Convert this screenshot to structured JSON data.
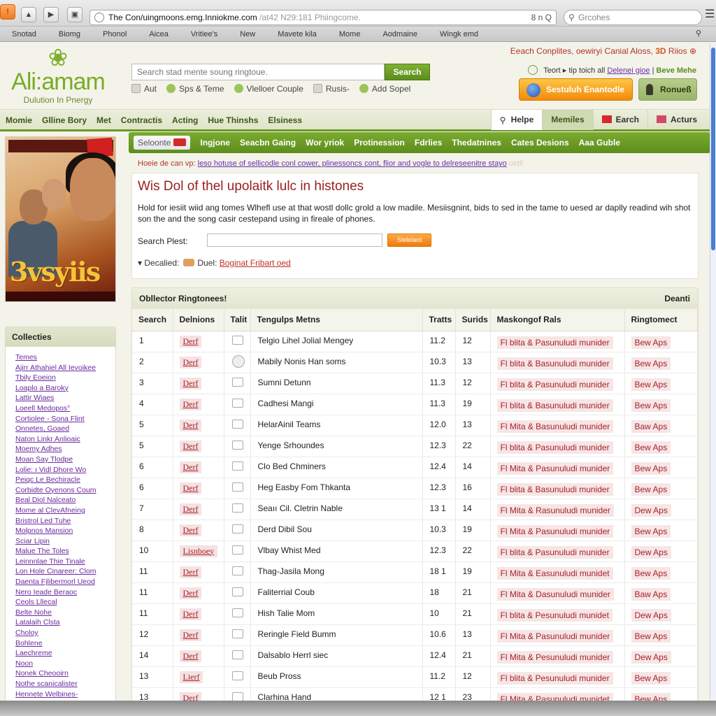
{
  "browser": {
    "url_main": "The Con/uingmoons.emg.Inniokme.com",
    "url_rest": " /at42 N29:181 Phiingcome.",
    "url_right": "8 n  Q",
    "search_placeholder": "Grcohes",
    "bookmarks": [
      "Snotad",
      "Biomg",
      "Phonol",
      "Aicea",
      "Vritiee's",
      "New",
      "Mavete kila",
      "Mome",
      "Aodmaine",
      "Wingk emd"
    ]
  },
  "site": {
    "logo_name": "Ali:amam",
    "logo_tagline": "Dulution In Pnergy",
    "search_placeholder": "Search stad mente soung ringtoue.",
    "search_button": "Search",
    "quick_links": [
      "Aut",
      "Sps & Teme",
      "Vlelloer Couple",
      "Rusis-",
      "Add Sopel"
    ],
    "promo_text": "Eeach Conplites, oewiryi  Canial Aloss, ",
    "promo_num": "3D",
    "promo_tail": " Riios",
    "text_line_pre": "Teort  ▸ tip toich all ",
    "text_line_link": "Delenei gioe",
    "text_line_sep": " | ",
    "text_line_green": "Beve Mehe",
    "orange_button": "Sestuluh Enantodle",
    "green_button": "Ronueß"
  },
  "nav": {
    "left": [
      "Momie",
      "Glline Bory",
      "Met",
      "Contractis",
      "Acting",
      "Hue Thinshs",
      "Elsiness"
    ],
    "right": [
      {
        "label": "Helpe",
        "state": "active"
      },
      {
        "label": "Memiles",
        "state": "selected"
      },
      {
        "label": "Earch",
        "state": "normal"
      },
      {
        "label": "Acturs",
        "state": "normal"
      }
    ]
  },
  "sidebar": {
    "poster_title": "3vsyiis",
    "collections_title": "Collecties",
    "collections": [
      "Temes",
      "Ajirr Athahiel All Ievoikee",
      "Tbily Eoeion",
      "Loaplo a Baroky",
      "Lattir Wiaes",
      "Loeell Medopos°",
      "Cortiolee - Sona Flint",
      "Onnetes, Goaed",
      "Naton Linkr Anlioaic",
      "Moemy Adhes",
      "Moan Say Tlodpe",
      "Lolie: ı Vidl Dhore Wo",
      "Peiqc Le Bechiracle",
      "Corbidte Oyenons Coum",
      "Beal Diol Nalceato",
      "Mome al ClevAfneing",
      "Bristrol Led Tuhe",
      "Molpnos Mansion",
      "Sciar Lipin",
      "Malue The Toles",
      "Leinnnlae Thie Tinale",
      "Lon Hole Cinareer: Clom",
      "Daenta Fjlibermorl Ueod",
      "Nero Ieade Beraoc",
      "Ceols Lllecal",
      "Belte Nohe",
      "Latalaih Clsta",
      "Choloy",
      "Bohlene",
      "Laechreme",
      "Noon",
      "Nonek Cheooirn",
      "Nothe scanicalister",
      "Hennete Welbines-"
    ]
  },
  "main": {
    "tabs": [
      "Seloonte",
      "Ingjone",
      "Seacbn Gaing",
      "Wor yriok",
      "Protinession",
      "Fdrlies",
      "Thedatnines",
      "Cates Desions",
      "Aaa Guble"
    ],
    "breadline_label": "Hoeie de can vp: ",
    "breadline_link": "leso hotuse of sellicodle conl cower, plinessoncs cont, flior and vogle to delreseenitre stayo",
    "breadline_faded": " oetll",
    "info_title": "Wis Dol of thel upolaitk lulc in histones",
    "info_desc": "Hold for iesiit wiid ang tomes Wlhefl use at that wostl dollc grold a low madile. Mesiisgnint, bids to sed in the tame to uesed ar daplly readind wih shot son the and the song casir cestepand using in fireale of phones.",
    "search_label": "Search Plest:",
    "search_value": "",
    "search_button": "Stelelard",
    "detail_label": "▾  Decalied:",
    "detail_mid": "Duel:",
    "detail_link": "Boginat Fribart oed"
  },
  "table": {
    "title": "Obllector Ringtonees!",
    "title_right": "Deanti",
    "columns": [
      "Search",
      "Delnions",
      "Talit",
      "Tengulps Metns",
      "Tratts",
      "Surids",
      "Maskongof Rals",
      "Ringtomect"
    ],
    "rows": [
      {
        "search": "1",
        "def": "Derf",
        "ctl": "box",
        "name": "Telgio Lihel  Jolial Mengey",
        "tratts": "11.2",
        "surids": "12",
        "mask": "Fl blita & Pasunuludi munider",
        "ring": "Bew Aps"
      },
      {
        "search": "2",
        "def": "Derf",
        "ctl": "round",
        "name": "Mabily Nonis Han soms",
        "tratts": "10.3",
        "surids": "13",
        "mask": "Fl blita & Basunuludi munider",
        "ring": "Bew Aps"
      },
      {
        "search": "3",
        "def": "Derf",
        "ctl": "box",
        "name": "Sumni Detunn",
        "tratts": "11.3",
        "surids": "12",
        "mask": "Fl blita & Pasunuludi munider",
        "ring": "Bew Aps"
      },
      {
        "search": "4",
        "def": "Derf",
        "ctl": "box",
        "name": "Cadhesi Mangi",
        "tratts": "11.3",
        "surids": "19",
        "mask": "Fl blita & Basunuludi munider",
        "ring": "Bew Aps"
      },
      {
        "search": "5",
        "def": "Derf",
        "ctl": "box",
        "name": "HelarAinil Teams",
        "tratts": "12.0",
        "surids": "13",
        "mask": "Fl Mita & Basunuludi munider",
        "ring": "Baw Aps"
      },
      {
        "search": "5",
        "def": "Derf",
        "ctl": "box",
        "name": "Yenge Srhoundes",
        "tratts": "12.3",
        "surids": "22",
        "mask": "Fl blita & Pasunuludi munider",
        "ring": "Bew Aps"
      },
      {
        "search": "6",
        "def": "Derf",
        "ctl": "box",
        "name": "Clo Bed Chminers",
        "tratts": "12.4",
        "surids": "14",
        "mask": "Fl Mita & Pasunuludi munider",
        "ring": "Bew Aps"
      },
      {
        "search": "6",
        "def": "Derf",
        "ctl": "box",
        "name": "Heg Easby Fom Thkanta",
        "tratts": "12.3",
        "surids": "16",
        "mask": "Fl blita & Basunuludi munider",
        "ring": "Bew Aps"
      },
      {
        "search": "7",
        "def": "Derf",
        "ctl": "box",
        "name": "Seaıı Cil. Cletrin Nable",
        "tratts": "13 1",
        "surids": "14",
        "mask": "Fl Mita & Rasunuludi munider",
        "ring": "Dew Aps"
      },
      {
        "search": "8",
        "def": "Derf",
        "ctl": "box",
        "name": "Derd Dibil Sou",
        "tratts": "10.3",
        "surids": "19",
        "mask": "Fl Mita & Pasunuludi munider",
        "ring": "Bew Aps"
      },
      {
        "search": "10",
        "def": "Lisnboey",
        "ctl": "box",
        "name": "Vlbay Whist Med",
        "tratts": "12.3",
        "surids": "22",
        "mask": "Fl blita & Pasunuludi munider",
        "ring": "Dew Aps"
      },
      {
        "search": "11",
        "def": "Derf",
        "ctl": "box",
        "name": "Thag-Jasila Mong",
        "tratts": "18 1",
        "surids": "19",
        "mask": "Fl Mita & Easunuludi munidet",
        "ring": "Bew Aps"
      },
      {
        "search": "11",
        "def": "Derf",
        "ctl": "box",
        "name": "Faliterrial Coub",
        "tratts": "18",
        "surids": "21",
        "mask": "Fl Mita & Dasunuludi munider",
        "ring": "Baw Aps"
      },
      {
        "search": "11",
        "def": "Derf",
        "ctl": "box",
        "name": "Hish Talie Mom",
        "tratts": "10",
        "surids": "21",
        "mask": "Fl blita & Pesunuludi munidet",
        "ring": "Dew Aps"
      },
      {
        "search": "12",
        "def": "Derf",
        "ctl": "box",
        "name": "Reringle Field Bumm",
        "tratts": "10.6",
        "surids": "13",
        "mask": "Fl Mita & Pasunuludi munider",
        "ring": "Bew Aps"
      },
      {
        "search": "14",
        "def": "Derf",
        "ctl": "box",
        "name": "Dalsablo Herrl siec",
        "tratts": "12.4",
        "surids": "21",
        "mask": "Fl Mita & Pesunuludi munider",
        "ring": "Dew Aps"
      },
      {
        "search": "13",
        "def": "Lierf",
        "ctl": "box",
        "name": "Beub Pross",
        "tratts": "11.2",
        "surids": "12",
        "mask": "Fl blita & Pesunuludi munider",
        "ring": "Bew Aps"
      },
      {
        "search": "13",
        "def": "Derf",
        "ctl": "box",
        "name": "Clarhina Hand",
        "tratts": "12 1",
        "surids": "23",
        "mask": "Fl Mita & Pasunuludi munidet",
        "ring": "Bew Aps"
      }
    ]
  },
  "colors": {
    "brand_green": "#6b9a25",
    "accent_orange": "#f28a0a",
    "link_purple": "#6b2fae",
    "title_red": "#9a1e1e"
  }
}
